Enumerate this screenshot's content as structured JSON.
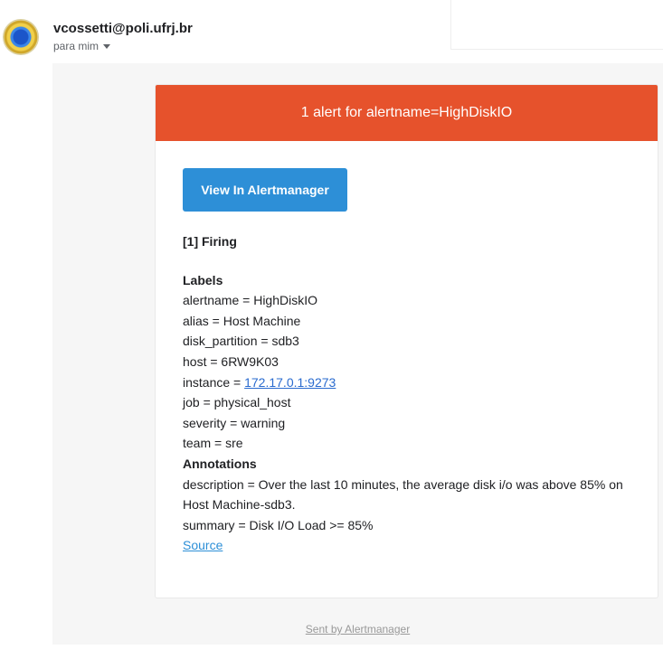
{
  "header": {
    "sender": "vcossetti@poli.ufrj.br",
    "recipient": "para mim"
  },
  "card": {
    "title": "1 alert for alertname=HighDiskIO",
    "button_label": "View In Alertmanager",
    "firing_label": "[1] Firing",
    "labels_heading": "Labels",
    "labels": [
      "alertname = HighDiskIO",
      "alias = Host Machine",
      "disk_partition = sdb3",
      "host = 6RW9K03"
    ],
    "instance_prefix": "instance = ",
    "instance_link": "172.17.0.1:9273",
    "labels_after": [
      "job = physical_host",
      "severity = warning",
      "team = sre"
    ],
    "annotations_heading": "Annotations",
    "description": "description = Over the last 10 minutes, the average disk i/o was above 85% on Host Machine-sdb3.",
    "summary": "summary = Disk I/O Load >= 85%",
    "source_link": "Source"
  },
  "footer": {
    "text": "Sent by Alertmanager"
  },
  "colors": {
    "header_bg": "#e6522c",
    "button_bg": "#2d8fd7",
    "link": "#2a6bcf"
  }
}
